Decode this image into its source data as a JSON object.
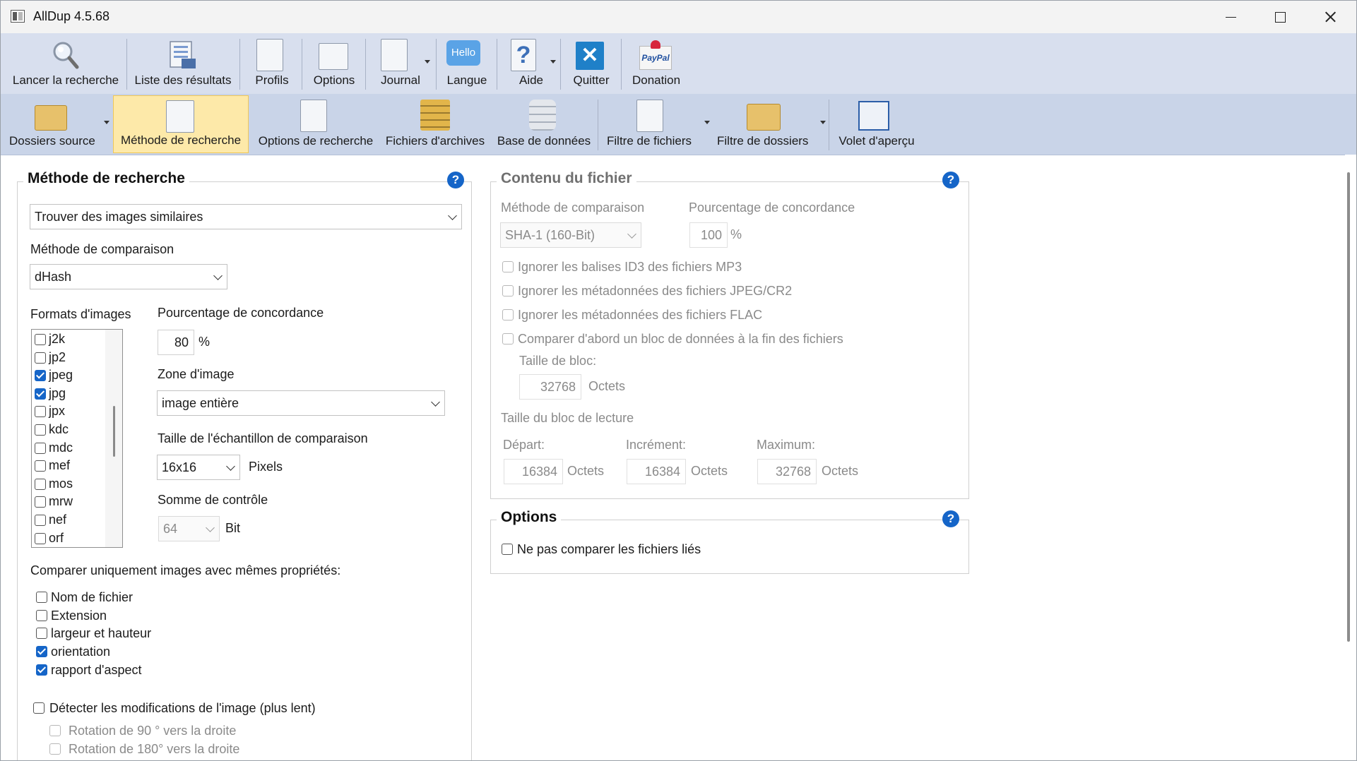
{
  "window": {
    "title": "AllDup 4.5.68"
  },
  "toolbar_main": [
    {
      "label": "Lancer la recherche",
      "icon": "magnifier-icon"
    },
    {
      "label": "Liste des résultats",
      "icon": "results-list-icon"
    },
    {
      "label": "Profils",
      "icon": "profiles-icon"
    },
    {
      "label": "Options",
      "icon": "options-icon"
    },
    {
      "label": "Journal",
      "icon": "journal-icon"
    },
    {
      "label": "Langue",
      "icon": "language-icon",
      "badge": "Hello"
    },
    {
      "label": "Aide",
      "icon": "help-icon",
      "glyph": "?"
    },
    {
      "label": "Quitter",
      "icon": "quit-icon",
      "glyph": "✕"
    },
    {
      "label": "Donation",
      "icon": "paypal-icon",
      "badge": "PayPal"
    }
  ],
  "toolbar_secondary": [
    {
      "label": "Dossiers source",
      "icon": "source-folders-icon"
    },
    {
      "label": "Méthode de recherche",
      "icon": "search-method-icon",
      "selected": true
    },
    {
      "label": "Options de recherche",
      "icon": "search-options-icon"
    },
    {
      "label": "Fichiers d'archives",
      "icon": "archive-files-icon"
    },
    {
      "label": "Base de données",
      "icon": "database-icon"
    },
    {
      "label": "Filtre de fichiers",
      "icon": "file-filter-icon"
    },
    {
      "label": "Filtre de dossiers",
      "icon": "folder-filter-icon"
    },
    {
      "label": "Volet d'aperçu",
      "icon": "preview-pane-icon"
    }
  ],
  "search_method": {
    "title": "Méthode de recherche",
    "method_value": "Trouver des images similaires",
    "compare_label": "Méthode de comparaison",
    "compare_value": "dHash",
    "formats_label": "Formats d'images",
    "formats": [
      {
        "name": "j2k",
        "checked": false
      },
      {
        "name": "jp2",
        "checked": false
      },
      {
        "name": "jpeg",
        "checked": true
      },
      {
        "name": "jpg",
        "checked": true
      },
      {
        "name": "jpx",
        "checked": false
      },
      {
        "name": "kdc",
        "checked": false
      },
      {
        "name": "mdc",
        "checked": false
      },
      {
        "name": "mef",
        "checked": false
      },
      {
        "name": "mos",
        "checked": false
      },
      {
        "name": "mrw",
        "checked": false
      },
      {
        "name": "nef",
        "checked": false
      },
      {
        "name": "orf",
        "checked": false
      }
    ],
    "match_label": "Pourcentage de concordance",
    "match_value": "80",
    "percent_unit": "%",
    "zone_label": "Zone d'image",
    "zone_value": "image entière",
    "sample_label": "Taille de l'échantillon de comparaison",
    "sample_value": "16x16",
    "sample_unit": "Pixels",
    "checksum_label": "Somme de contrôle",
    "checksum_value": "64",
    "checksum_unit": "Bit",
    "same_props_label": "Comparer uniquement images avec mêmes propriétés:",
    "same_props": [
      {
        "name": "Nom de fichier",
        "checked": false
      },
      {
        "name": "Extension",
        "checked": false
      },
      {
        "name": "largeur et hauteur",
        "checked": false
      },
      {
        "name": "orientation",
        "checked": true
      },
      {
        "name": "rapport d'aspect",
        "checked": true
      }
    ],
    "detect_label": "Détecter les modifications de l'image (plus lent)",
    "rotate90_label": "Rotation de 90 ° vers la droite",
    "rotate180_label": "Rotation de 180° vers la droite"
  },
  "file_content": {
    "title": "Contenu du fichier",
    "compare_label": "Méthode de comparaison",
    "compare_value": "SHA-1 (160-Bit)",
    "match_label": "Pourcentage de concordance",
    "match_value": "100",
    "percent_unit": "%",
    "ignore_id3": "Ignorer les balises ID3 des fichiers MP3",
    "ignore_jpeg": "Ignorer les métadonnées des fichiers JPEG/CR2",
    "ignore_flac": "Ignorer les métadonnées des fichiers FLAC",
    "compare_block": "Comparer d'abord un bloc de données à la fin des fichiers",
    "block_size_label": "Taille de bloc:",
    "block_size_value": "32768",
    "unit_bytes": "Octets",
    "read_block_label": "Taille du bloc de lecture",
    "start_label": "Départ:",
    "start_value": "16384",
    "increment_label": "Incrément:",
    "increment_value": "16384",
    "max_label": "Maximum:",
    "max_value": "32768"
  },
  "options": {
    "title": "Options",
    "no_linked": "Ne pas comparer les fichiers liés"
  },
  "help_glyph": "?",
  "colors": {
    "accent": "#1565c8",
    "toolbar_top": "#d8dfee",
    "toolbar_bottom": "#c9d4e8",
    "selected": "#fde9a9"
  }
}
